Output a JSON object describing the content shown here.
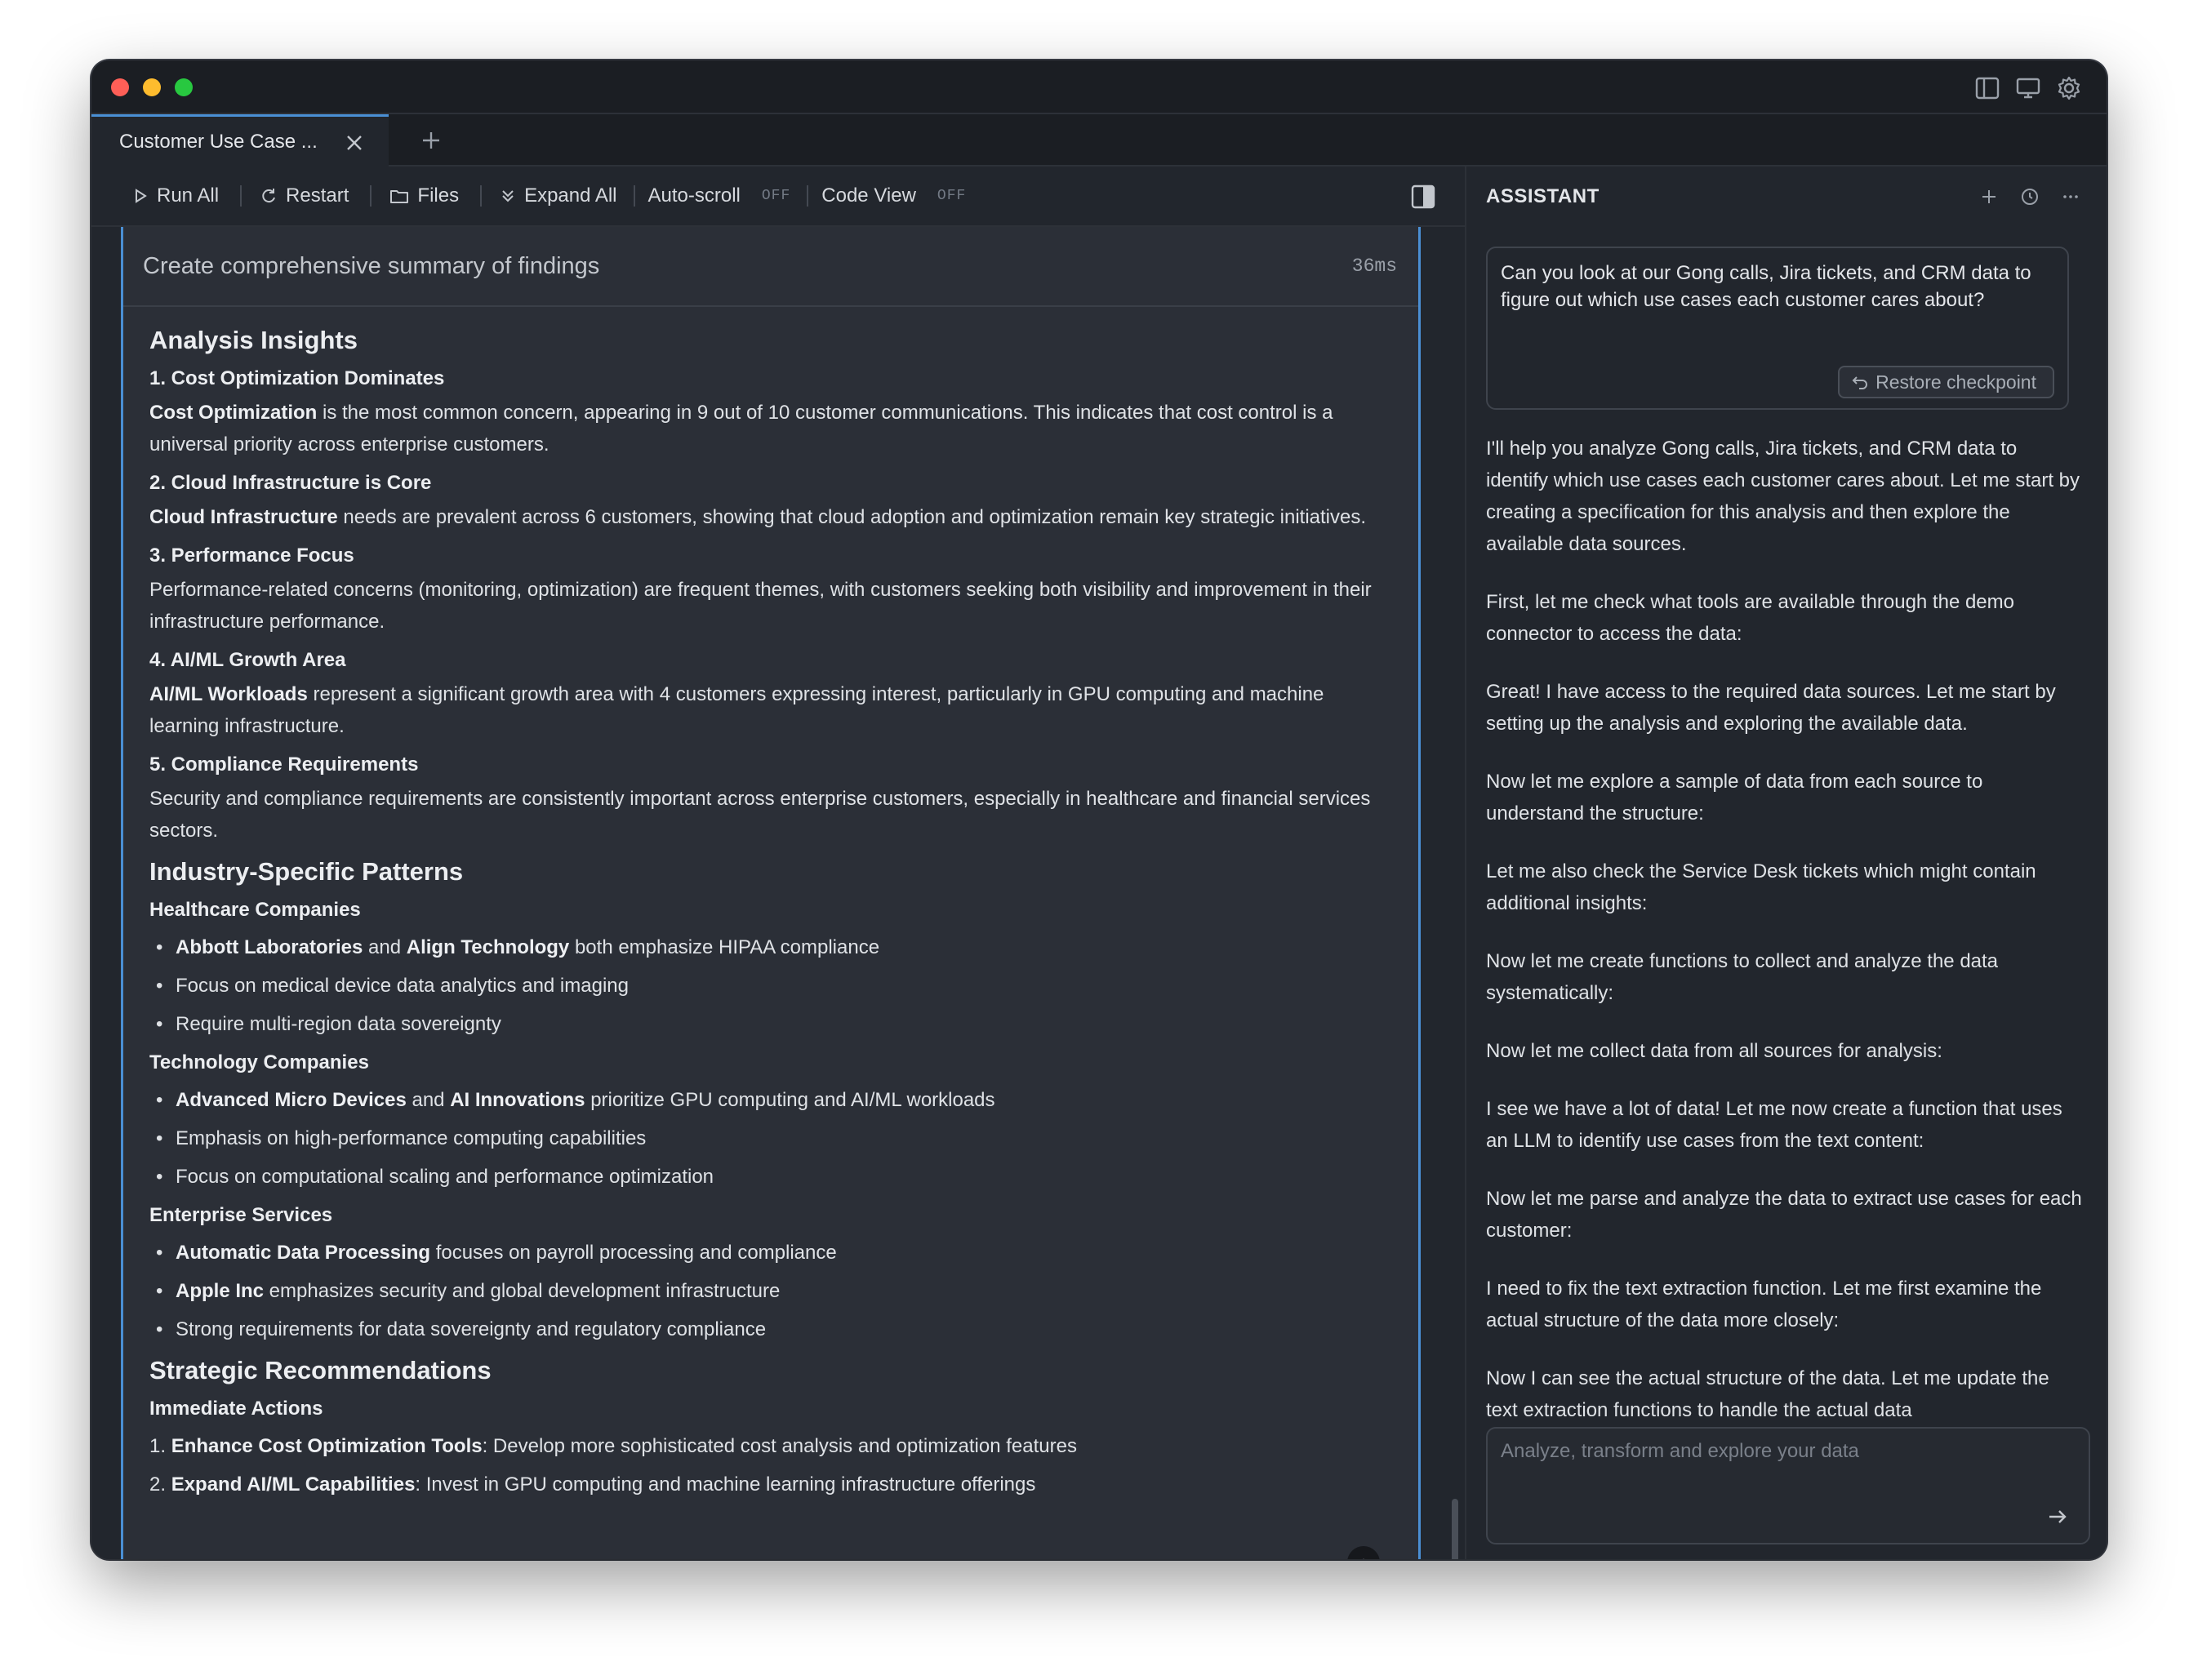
{
  "tabs": {
    "active_label": "Customer Use Case ..."
  },
  "toolbar": {
    "run_all": "Run All",
    "restart": "Restart",
    "files": "Files",
    "expand_all": "Expand All",
    "auto_scroll": "Auto-scroll",
    "auto_scroll_state": "OFF",
    "code_view": "Code View",
    "code_view_state": "OFF"
  },
  "cell": {
    "title": "Create comprehensive summary of findings",
    "time": "36ms",
    "id": "#6854",
    "analysis_heading": "Analysis Insights",
    "insights": [
      {
        "heading": "1. Cost Optimization Dominates",
        "bold": "Cost Optimization",
        "text": " is the most common concern, appearing in 9 out of 10 customer communications. This indicates that cost control is a universal priority across enterprise customers."
      },
      {
        "heading": "2. Cloud Infrastructure is Core",
        "bold": "Cloud Infrastructure",
        "text": " needs are prevalent across 6 customers, showing that cloud adoption and optimization remain key strategic initiatives."
      },
      {
        "heading": "3. Performance Focus",
        "bold": "",
        "text": "Performance-related concerns (monitoring, optimization) are frequent themes, with customers seeking both visibility and improvement in their infrastructure performance."
      },
      {
        "heading": "4. AI/ML Growth Area",
        "bold": "AI/ML Workloads",
        "text": " represent a significant growth area with 4 customers expressing interest, particularly in GPU computing and machine learning infrastructure."
      },
      {
        "heading": "5. Compliance Requirements",
        "bold": "",
        "text": "Security and compliance requirements are consistently important across enterprise customers, especially in healthcare and financial services sectors."
      }
    ],
    "industry_heading": "Industry-Specific Patterns",
    "healthcare": {
      "heading": "Healthcare Companies",
      "b1": "Abbott Laboratories",
      "and1": " and ",
      "b2": "Align Technology",
      "rest1": " both emphasize HIPAA compliance",
      "item2": "Focus on medical device data analytics and imaging",
      "item3": "Require multi-region data sovereignty"
    },
    "technology": {
      "heading": "Technology Companies",
      "b1": "Advanced Micro Devices",
      "and1": " and ",
      "b2": "AI Innovations",
      "rest1": " prioritize GPU computing and AI/ML workloads",
      "item2": "Emphasis on high-performance computing capabilities",
      "item3": "Focus on computational scaling and performance optimization"
    },
    "enterprise": {
      "heading": "Enterprise Services",
      "b1": "Automatic Data Processing",
      "rest1": " focuses on payroll processing and compliance",
      "b2": "Apple Inc",
      "rest2": " emphasizes security and global development infrastructure",
      "item3": "Strong requirements for data sovereignty and regulatory compliance"
    },
    "strategic_heading": "Strategic Recommendations",
    "immediate_heading": "Immediate Actions",
    "actions": [
      {
        "num": "1. ",
        "bold": "Enhance Cost Optimization Tools",
        "text": ": Develop more sophisticated cost analysis and optimization features"
      },
      {
        "num": "2. ",
        "bold": "Expand AI/ML Capabilities",
        "text": ": Invest in GPU computing and machine learning infrastructure offerings"
      }
    ]
  },
  "assistant": {
    "title": "ASSISTANT",
    "user_message": "Can you look at our Gong calls, Jira tickets, and CRM data to figure out which use cases each customer cares about?",
    "restore_label": "Restore checkpoint",
    "messages": [
      "I'll help you analyze Gong calls, Jira tickets, and CRM data to identify which use cases each customer cares about. Let me start by creating a specification for this analysis and then explore the available data sources.",
      "First, let me check what tools are available through the demo connector to access the data:",
      "Great! I have access to the required data sources. Let me start by setting up the analysis and exploring the available data.",
      "Now let me explore a sample of data from each source to understand the structure:",
      "Let me also check the Service Desk tickets which might contain additional insights:",
      "Now let me create functions to collect and analyze the data systematically:",
      "Now let me collect data from all sources for analysis:",
      "I see we have a lot of data! Let me now create a function that uses an LLM to identify use cases from the text content:",
      "Now let me parse and analyze the data to extract use cases for each customer:",
      "I need to fix the text extraction function. Let me first examine the actual structure of the data more closely:",
      "Now I can see the actual structure of the data. Let me update the text extraction functions to handle the actual data"
    ],
    "composer_placeholder": "Analyze, transform and explore your data"
  }
}
